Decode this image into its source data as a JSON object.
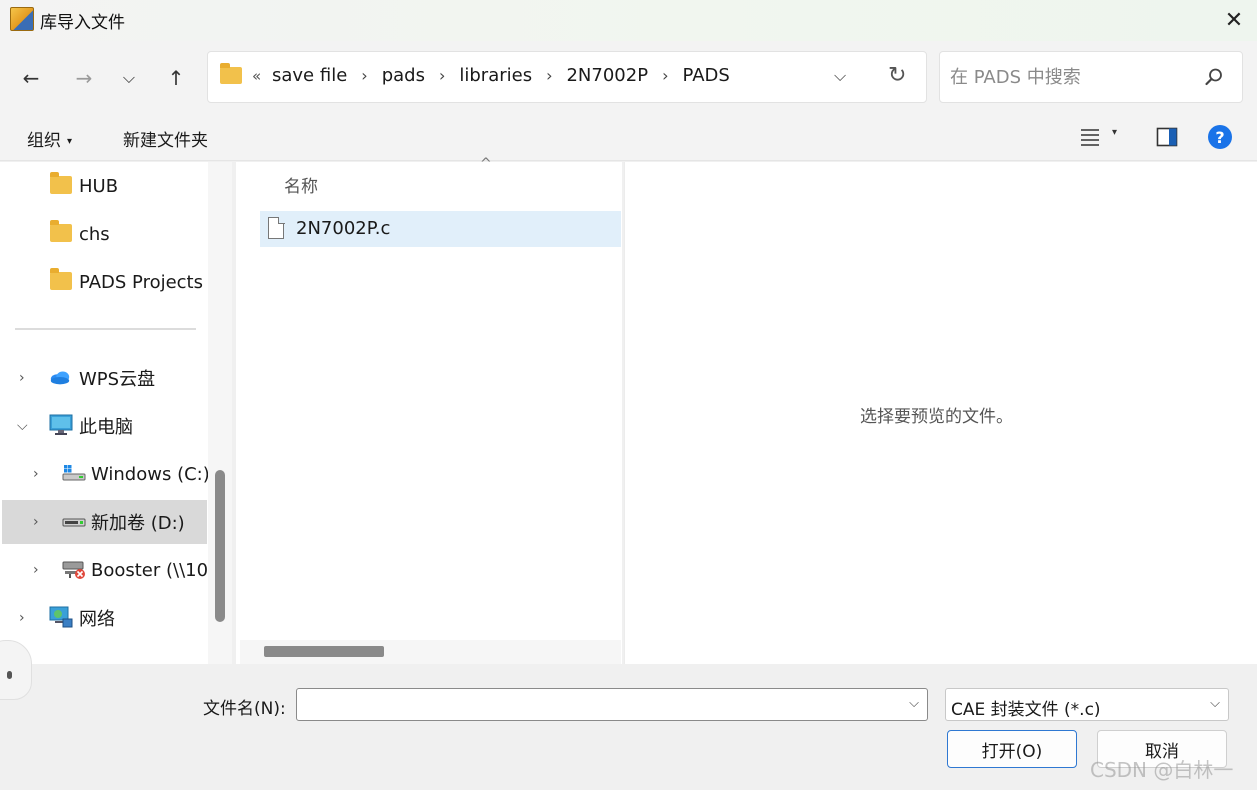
{
  "window": {
    "title": "库导入文件",
    "app_icon": "pads-app-icon",
    "close_glyph": "✕"
  },
  "navigation": {
    "back_glyph": "←",
    "forward_glyph": "→",
    "recent_glyph": "⌵",
    "up_glyph": "↑",
    "address": {
      "overflow": "«",
      "breadcrumbs": [
        "save file",
        "pads",
        "libraries",
        "2N7002P",
        "PADS"
      ],
      "separator": "›",
      "dropdown_glyph": "⌵",
      "refresh_glyph": "↻"
    },
    "search": {
      "placeholder": "在 PADS 中搜索",
      "icon": "search-icon"
    }
  },
  "toolbar": {
    "organize_label": "组织",
    "organize_caret": "▾",
    "new_folder_label": "新建文件夹",
    "view_caret": "▾",
    "help_glyph": "?"
  },
  "sidebar": {
    "items": [
      {
        "label": "HUB",
        "icon": "folder-icon",
        "chevron": ""
      },
      {
        "label": "chs",
        "icon": "folder-icon",
        "chevron": ""
      },
      {
        "label": "PADS Projects",
        "icon": "folder-icon",
        "chevron": ""
      },
      {
        "label": "WPS云盘",
        "icon": "cloud-icon",
        "chevron": "›"
      },
      {
        "label": "此电脑",
        "icon": "computer-icon",
        "chevron": "⌵"
      },
      {
        "label": "Windows (C:)",
        "icon": "windows-drive-icon",
        "chevron": "›"
      },
      {
        "label": "新加卷 (D:)",
        "icon": "drive-icon",
        "chevron": "›"
      },
      {
        "label": "Booster (\\\\10.",
        "icon": "network-drive-icon",
        "chevron": "›"
      },
      {
        "label": "网络",
        "icon": "network-icon",
        "chevron": "›"
      }
    ],
    "selected_index": 6
  },
  "filelist": {
    "column_name": "名称",
    "sort_caret": "^",
    "files": [
      {
        "name": "2N7002P.c",
        "icon": "file-icon"
      }
    ]
  },
  "preview": {
    "message": "选择要预览的文件。"
  },
  "bottom": {
    "filename_label": "文件名(N):",
    "filename_value": "",
    "filename_caret": "⌵",
    "file_type": "CAE 封装文件 (*.c)",
    "file_type_caret": "⌵",
    "open_label": "打开(O)",
    "cancel_label": "取消"
  },
  "watermark": "CSDN @白林一",
  "colors": {
    "accent": "#1a73e8",
    "folder": "#f2c14b",
    "selection": "#e1effa",
    "sidebar_selection": "#d9d9d9",
    "open_border": "#2f78d2"
  }
}
